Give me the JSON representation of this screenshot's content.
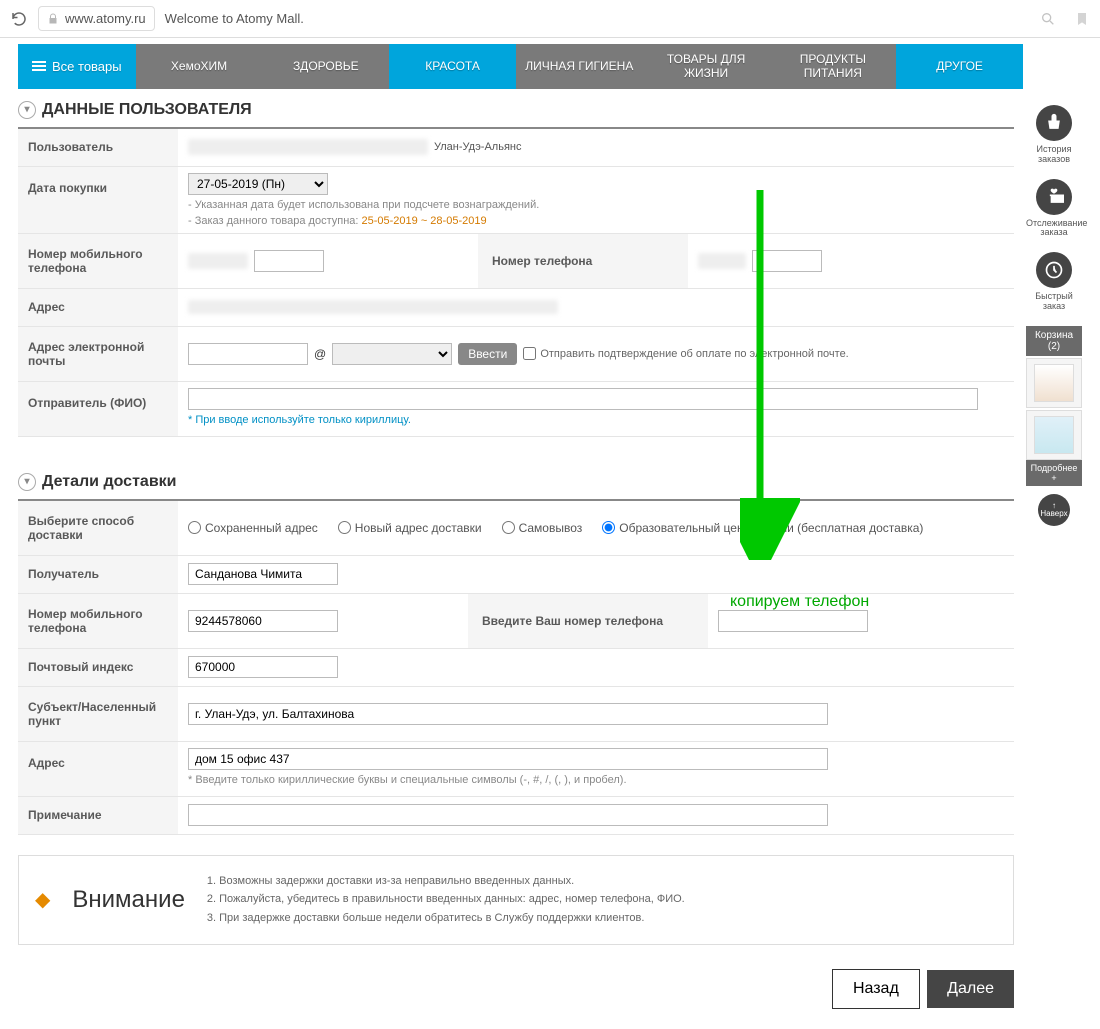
{
  "browser": {
    "url": "www.atomy.ru",
    "title": "Welcome to Atomy Mall."
  },
  "nav": {
    "all": "Все товары",
    "items": [
      "ХемоХИМ",
      "ЗДОРОВЬЕ",
      "КРАСОТА",
      "ЛИЧНАЯ ГИГИЕНА",
      "ТОВАРЫ ДЛЯ ЖИЗНИ",
      "ПРОДУКТЫ ПИТАНИЯ",
      "ДРУГОЕ"
    ]
  },
  "section_user": "ДАННЫЕ ПОЛЬЗОВАТЕЛЯ",
  "user": {
    "user_label": "Пользователь",
    "user_suffix": "Улан-Удэ-Альянс",
    "date_label": "Дата покупки",
    "date_value": "27-05-2019 (Пн)",
    "date_hint1": "- Указанная дата будет использована при подсчете вознаграждений.",
    "date_hint2a": "- Заказ данного товара доступна: ",
    "date_hint2b": "25-05-2019 ~ 28-05-2019",
    "mobile_label": "Номер мобильного телефона",
    "phone_label": "Номер телефона",
    "address_label": "Адрес",
    "email_label": "Адрес электронной почты",
    "at": "@",
    "enter_btn": "Ввести",
    "email_checkbox": "Отправить подтверждение об оплате по электронной почте.",
    "sender_label": "Отправитель (ФИО)",
    "sender_hint": "* При вводе используйте только кириллицу."
  },
  "section_delivery": "Детали доставки",
  "delivery": {
    "method_label": "Выберите способ доставки",
    "methods": [
      "Сохраненный адрес",
      "Новый адрес доставки",
      "Самовывоз",
      "Образовательный центр Атоми (бесплатная доставка)"
    ],
    "recipient_label": "Получатель",
    "recipient_value": "Санданова Чимита",
    "mobile_label": "Номер мобильного телефона",
    "mobile_value": "9244578060",
    "phone_label2": "Введите Ваш номер телефона",
    "postal_label": "Почтовый индекс",
    "postal_value": "670000",
    "city_label": "Субъект/Населенный пункт",
    "city_value": "г. Улан-Удэ, ул. Балтахинова",
    "address_label": "Адрес",
    "address_value": "дом 15 офис 437",
    "address_hint": "* Введите только кириллические буквы и специальные символы (-, #, /, (, ), и пробел).",
    "note_label": "Примечание"
  },
  "side": {
    "history": "История заказов",
    "tracking": "Отслеживание заказа",
    "quick": "Быстрый заказ",
    "cart_label": "Корзина (2)",
    "more": "Подробнее +",
    "top": "Наверх"
  },
  "attention": {
    "title": "Внимание",
    "lines": [
      "1. Возможны задержки доставки из-за неправильно введенных данных.",
      "2. Пожалуйста, убедитесь в правильности введенных данных: адрес, номер телефона, ФИО.",
      "3. При задержке доставки больше недели обратитесь в Службу поддержки клиентов."
    ]
  },
  "buttons": {
    "back": "Назад",
    "next": "Далее"
  },
  "annotation": "копируем телефон"
}
